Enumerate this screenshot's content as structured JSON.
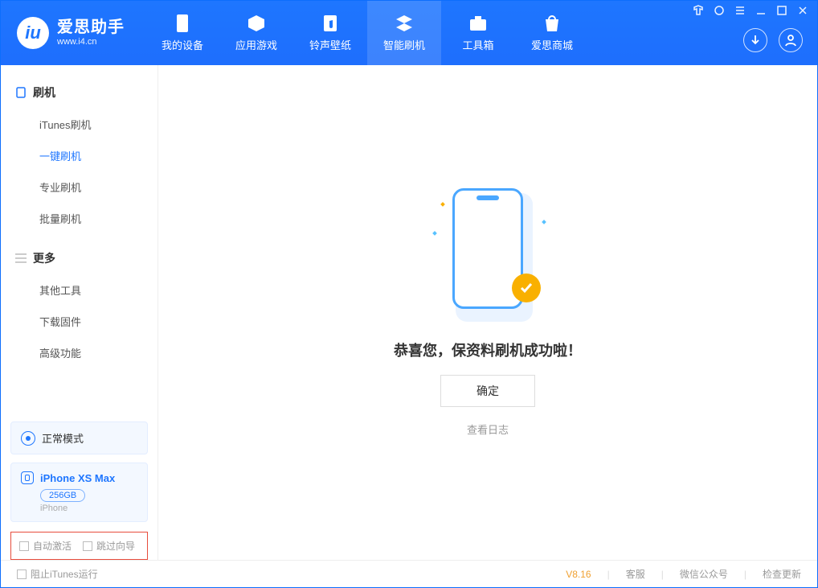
{
  "brand": {
    "name": "爱思助手",
    "url": "www.i4.cn"
  },
  "nav": [
    {
      "key": "device",
      "label": "我的设备"
    },
    {
      "key": "apps",
      "label": "应用游戏"
    },
    {
      "key": "ring",
      "label": "铃声壁纸"
    },
    {
      "key": "flash",
      "label": "智能刷机"
    },
    {
      "key": "tools",
      "label": "工具箱"
    },
    {
      "key": "store",
      "label": "爱思商城"
    }
  ],
  "nav_active": "flash",
  "sidebar": {
    "group1_title": "刷机",
    "group2_title": "更多",
    "group1": [
      {
        "key": "itunes",
        "label": "iTunes刷机"
      },
      {
        "key": "onekey",
        "label": "一键刷机"
      },
      {
        "key": "pro",
        "label": "专业刷机"
      },
      {
        "key": "batch",
        "label": "批量刷机"
      }
    ],
    "group1_active": "onekey",
    "group2": [
      {
        "key": "other",
        "label": "其他工具"
      },
      {
        "key": "fw",
        "label": "下载固件"
      },
      {
        "key": "adv",
        "label": "高级功能"
      }
    ]
  },
  "mode_card": {
    "label": "正常模式"
  },
  "device_card": {
    "name": "iPhone XS Max",
    "capacity": "256GB",
    "sub": "iPhone"
  },
  "opts": {
    "a": "自动激活",
    "b": "跳过向导"
  },
  "main": {
    "message": "恭喜您，保资料刷机成功啦！",
    "ok": "确定",
    "log": "查看日志"
  },
  "footer": {
    "stop_itunes": "阻止iTunes运行",
    "version": "V8.16",
    "cs": "客服",
    "wx": "微信公众号",
    "upd": "检查更新"
  }
}
